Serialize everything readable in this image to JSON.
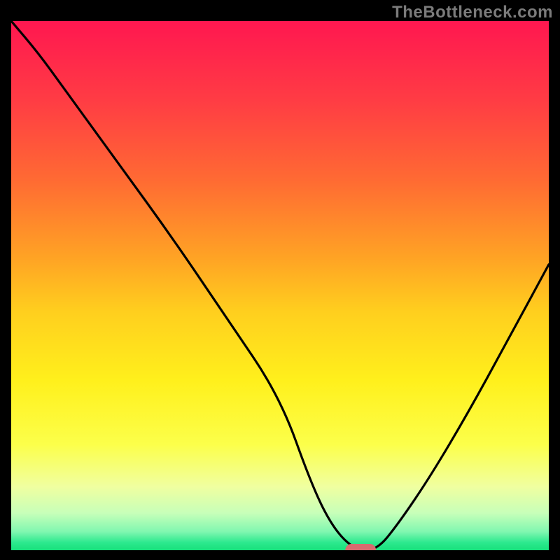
{
  "watermark": "TheBottleneck.com",
  "chart_data": {
    "type": "line",
    "title": "",
    "xlabel": "",
    "ylabel": "",
    "xlim": [
      0,
      100
    ],
    "ylim": [
      0,
      100
    ],
    "grid": false,
    "legend": false,
    "series": [
      {
        "name": "bottleneck-curve",
        "x": [
          0,
          5,
          10,
          20,
          30,
          40,
          50,
          56,
          60,
          64,
          68,
          72,
          78,
          85,
          92,
          100
        ],
        "y": [
          100,
          94,
          87,
          73,
          59,
          44,
          29,
          12,
          4,
          0,
          0,
          5,
          14,
          26,
          39,
          54
        ]
      }
    ],
    "marker": {
      "name": "optimal-point",
      "x": 65,
      "y": 0,
      "shape": "pill",
      "color": "#d76b6f"
    },
    "background_gradient": {
      "stops": [
        {
          "offset": 0.0,
          "color": "#ff1750"
        },
        {
          "offset": 0.15,
          "color": "#ff3c44"
        },
        {
          "offset": 0.3,
          "color": "#ff6a33"
        },
        {
          "offset": 0.45,
          "color": "#ffa424"
        },
        {
          "offset": 0.55,
          "color": "#ffcf1e"
        },
        {
          "offset": 0.68,
          "color": "#fff01c"
        },
        {
          "offset": 0.8,
          "color": "#fcff4a"
        },
        {
          "offset": 0.88,
          "color": "#f0ffa0"
        },
        {
          "offset": 0.93,
          "color": "#c7ffb9"
        },
        {
          "offset": 0.965,
          "color": "#80f7b0"
        },
        {
          "offset": 0.985,
          "color": "#2ee98f"
        },
        {
          "offset": 1.0,
          "color": "#17e07b"
        }
      ]
    }
  }
}
